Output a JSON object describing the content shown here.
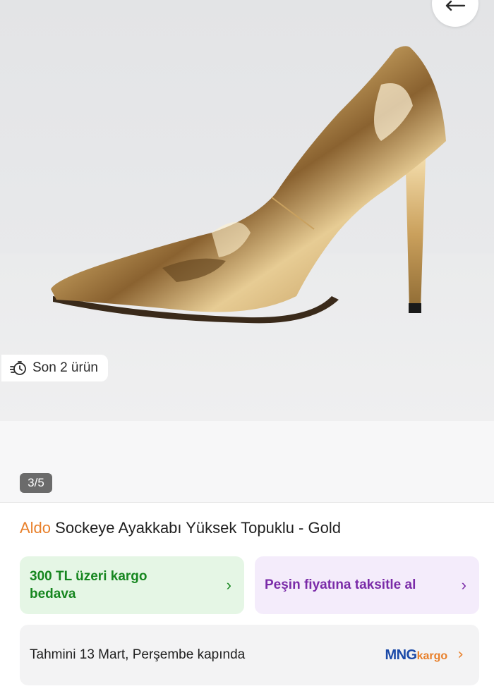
{
  "gallery": {
    "stock_badge": "Son 2 ürün",
    "counter": "3/5",
    "image_description_icon": "gold-stiletto-pump-image"
  },
  "header": {
    "back_icon": "back-arrow-icon"
  },
  "product": {
    "brand": "Aldo",
    "name": " Sockeye Ayakkabı Yüksek Topuklu - Gold"
  },
  "promos": {
    "shipping": "300 TL üzeri kargo bedava",
    "installment": "Peşin fiyatına taksitle al"
  },
  "delivery": {
    "text": "Tahmini 13 Mart, Perşembe kapında",
    "carrier_main": "MNG",
    "carrier_sub": "kargo"
  },
  "colors": {
    "brand_orange": "#e8802b",
    "green_text": "#16861f",
    "green_bg": "#e5f6e5",
    "purple_text": "#7a2ba8",
    "purple_bg": "#f4ecfb",
    "mng_blue": "#1b4aa8"
  }
}
